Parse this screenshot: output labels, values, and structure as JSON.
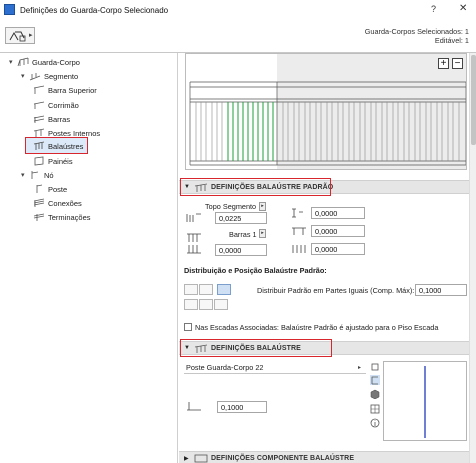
{
  "window": {
    "title": "Definições do Guarda-Corpo Selecionado",
    "help_label": "?",
    "close_label": "✕"
  },
  "header": {
    "favorites_icon": "favorites-icon",
    "selected_count": "Guarda-Corpos Selecionados: 1",
    "editable_count": "Editável: 1"
  },
  "tree": {
    "items": [
      {
        "label": "Guarda-Corpo",
        "level": 0,
        "expander": "▾",
        "icon": "railing-icon"
      },
      {
        "label": "Segmento",
        "level": 1,
        "expander": "▾",
        "icon": "segment-icon"
      },
      {
        "label": "Barra Superior",
        "level": 2,
        "expander": "",
        "icon": "top-rail-icon"
      },
      {
        "label": "Corrimão",
        "level": 2,
        "expander": "",
        "icon": "handrail-icon"
      },
      {
        "label": "Barras",
        "level": 2,
        "expander": "",
        "icon": "rails-icon"
      },
      {
        "label": "Postes Internos",
        "level": 2,
        "expander": "",
        "icon": "inner-posts-icon"
      },
      {
        "label": "Balaústres",
        "level": 2,
        "expander": "",
        "icon": "balusters-icon",
        "selected": true
      },
      {
        "label": "Painéis",
        "level": 2,
        "expander": "",
        "icon": "panels-icon"
      },
      {
        "label": "Nó",
        "level": 1,
        "expander": "▾",
        "icon": "node-icon"
      },
      {
        "label": "Poste",
        "level": 2,
        "expander": "",
        "icon": "post-icon"
      },
      {
        "label": "Conexões",
        "level": 2,
        "expander": "",
        "icon": "connections-icon"
      },
      {
        "label": "Terminações",
        "level": 2,
        "expander": "",
        "icon": "endings-icon"
      }
    ]
  },
  "preview": {
    "zoom_in": "+",
    "zoom_out": "−"
  },
  "sections": {
    "default_baluster": {
      "arrow": "▼",
      "label": "DEFINIÇÕES BALAÚSTRE PADRÃO"
    },
    "baluster": {
      "arrow": "▼",
      "label": "DEFINIÇÕES BALAÚSTRE"
    },
    "component": {
      "arrow": "▶",
      "label": "DEFINIÇÕES COMPONENTE BALAÚSTRE"
    }
  },
  "default_baluster": {
    "top_segment_label": "Topo Segmento",
    "top_segment_value": "0,0225",
    "bars_label": "Barras 1",
    "bottom_value": "0,0000",
    "right_top_value": "0,0000",
    "right_mid_value": "0,0000",
    "right_bottom_value": "0,0000"
  },
  "distribution": {
    "heading": "Distribuição e Posição Balaústre Padrão:",
    "distribute_label": "Distribuir Padrão em Partes Iguais (Comp. Máx):",
    "distribute_value": "0,1000",
    "stairs_checkbox_label": "Nas Escadas Associadas: Balaústre Padrão é ajustado para o Piso Escada",
    "stairs_checked": false
  },
  "baluster": {
    "type_label": "Poste Guarda-Corpo 22",
    "width_value": "0,1000"
  }
}
